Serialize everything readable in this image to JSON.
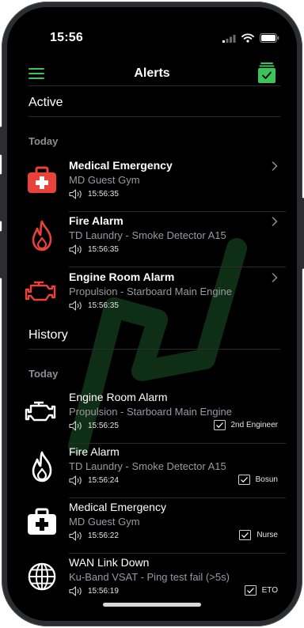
{
  "status": {
    "time": "15:56"
  },
  "nav": {
    "title": "Alerts",
    "accent": "#3cc45a"
  },
  "active": {
    "section": "Active",
    "day": "Today",
    "items": [
      {
        "icon": "medical-kit-icon",
        "icon_color": "#e8423b",
        "title": "Medical Emergency",
        "subtitle": "MD Guest Gym",
        "time": "15:56:35"
      },
      {
        "icon": "fire-icon",
        "icon_color": "#e8423b",
        "title": "Fire Alarm",
        "subtitle": "TD Laundry - Smoke Detector A15",
        "time": "15:56:35"
      },
      {
        "icon": "engine-icon",
        "icon_color": "#e8423b",
        "title": "Engine Room Alarm",
        "subtitle": "Propulsion - Starboard Main Engine",
        "time": "15:56:35"
      }
    ]
  },
  "history": {
    "section": "History",
    "day": "Today",
    "items": [
      {
        "icon": "engine-icon",
        "title": "Engine Room Alarm",
        "subtitle": "Propulsion - Starboard Main Engine",
        "time": "15:56:25",
        "ack_by": "2nd Engineer"
      },
      {
        "icon": "fire-icon",
        "title": "Fire Alarm",
        "subtitle": "TD Laundry - Smoke Detector A15",
        "time": "15:56:24",
        "ack_by": "Bosun"
      },
      {
        "icon": "medical-kit-icon",
        "title": "Medical Emergency",
        "subtitle": "MD Guest Gym",
        "time": "15:56:22",
        "ack_by": "Nurse"
      },
      {
        "icon": "globe-icon",
        "title": "WAN Link Down",
        "subtitle": "Ku-Band VSAT - Ping test fail (>5s)",
        "time": "15:56:19",
        "ack_by": "ETO"
      }
    ]
  }
}
